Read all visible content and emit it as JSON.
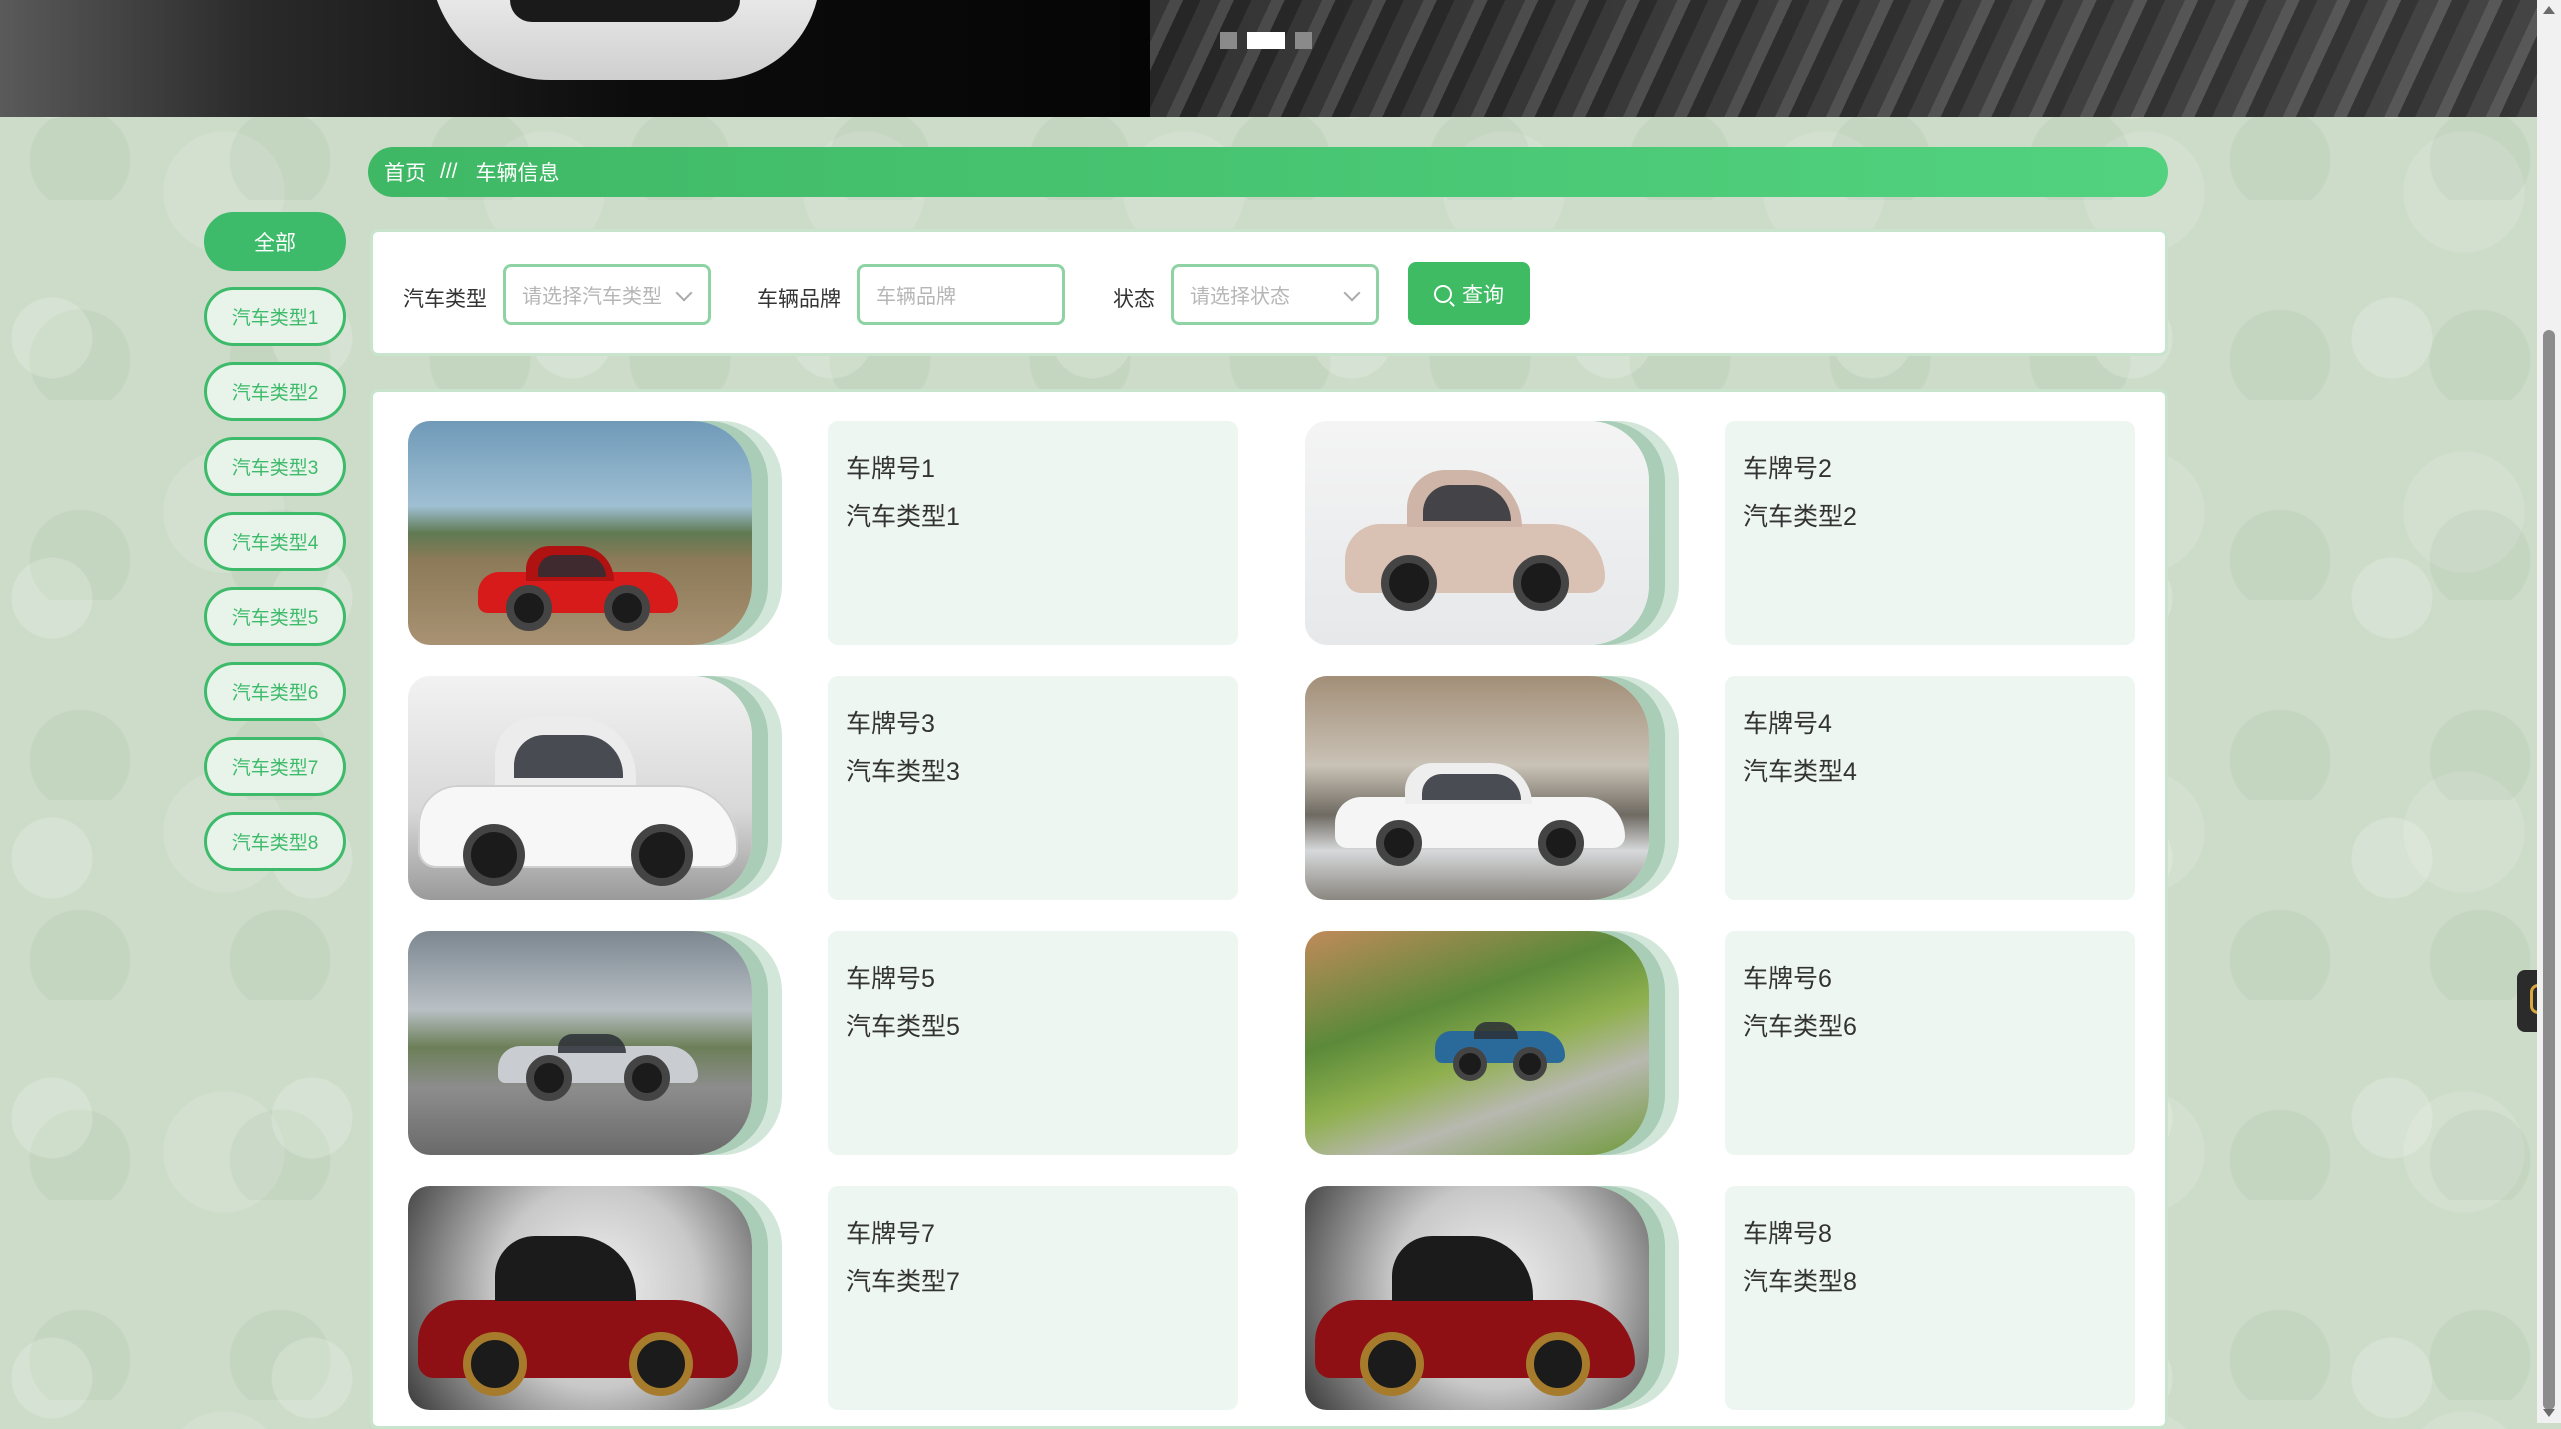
{
  "carousel": {
    "slides": 3,
    "active_index": 1
  },
  "breadcrumb": {
    "home": "首页",
    "separator": "///",
    "current": "车辆信息"
  },
  "categories": [
    "全部",
    "汽车类型1",
    "汽车类型2",
    "汽车类型3",
    "汽车类型4",
    "汽车类型5",
    "汽车类型6",
    "汽车类型7",
    "汽车类型8"
  ],
  "filter": {
    "car_type_label": "汽车类型",
    "car_type_placeholder": "请选择汽车类型",
    "brand_label": "车辆品牌",
    "brand_placeholder": "车辆品牌",
    "status_label": "状态",
    "status_placeholder": "请选择状态",
    "search_label": "查询"
  },
  "vehicles": [
    {
      "plate": "车牌号1",
      "type": "汽车类型1",
      "image": "red-sports-car"
    },
    {
      "plate": "车牌号2",
      "type": "汽车类型2",
      "image": "beige-compact-suv"
    },
    {
      "plate": "车牌号3",
      "type": "汽车类型3",
      "image": "white-mercedes-suv"
    },
    {
      "plate": "车牌号4",
      "type": "汽车类型4",
      "image": "white-suv-snow"
    },
    {
      "plate": "车牌号5",
      "type": "汽车类型5",
      "image": "silver-concept-car"
    },
    {
      "plate": "车牌号6",
      "type": "汽车类型6",
      "image": "blue-roadster"
    },
    {
      "plate": "车牌号7",
      "type": "汽车类型7",
      "image": "dark-red-supercar"
    },
    {
      "plate": "车牌号8",
      "type": "汽车类型8",
      "image": "dark-red-supercar"
    }
  ],
  "colors": {
    "accent": "#3dbb6a",
    "page_background": "#cddcc9",
    "card_background": "#eef6f1"
  }
}
